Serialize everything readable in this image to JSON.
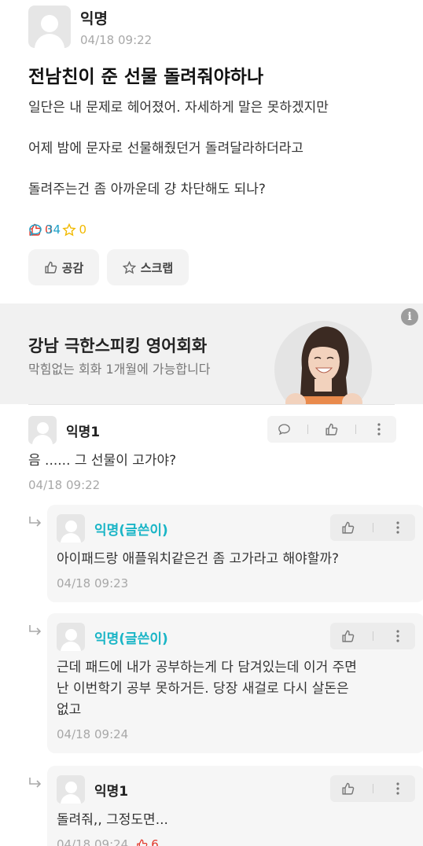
{
  "post": {
    "author": "익명",
    "time": "04/18 09:22",
    "title": "전남친이 준 선물 돌려줘야하나",
    "body": [
      "일단은 내 문제로 헤어졌어. 자세하게 말은 못하겠지만",
      "어제 밤에 문자로 선물해줬던거 돌려달라하더라고",
      "돌려주는건 좀 아까운데 걍 차단해도 되나?"
    ],
    "stats": {
      "likes": "0",
      "comments": "34",
      "scraps": "0"
    },
    "buttons": {
      "like": "공감",
      "scrap": "스크랩"
    }
  },
  "ad": {
    "title": "강남 극한스피킹 영어회화",
    "subtitle": "막힘없는 회화 1개월에 가능합니다",
    "info_icon": "i"
  },
  "comments": [
    {
      "author": "익명1",
      "text": "음 ...... 그 선물이 고가야?",
      "time": "04/18 09:22"
    }
  ],
  "replies": [
    {
      "author": "익명(글쓴이)",
      "text": "아이패드랑 애플워치같은건 좀 고가라고 해야할까?",
      "time": "04/18 09:23"
    },
    {
      "author": "익명(글쓴이)",
      "text_lines": [
        "근데 패드에 내가 공부하는게 다 담겨있는데 이거 주면",
        "난 이번학기 공부 못하거든. 당장 새걸로 다시 살돈은",
        "없고"
      ],
      "time": "04/18 09:24"
    },
    {
      "author": "익명1",
      "text": "돌려줘,, 그정도면...",
      "time": "04/18 09:24",
      "likes": "6"
    }
  ],
  "colors": {
    "like": "#e2372a",
    "comment": "#1fa2c9",
    "scrap": "#f1b900",
    "op": "#1ab5c6"
  }
}
